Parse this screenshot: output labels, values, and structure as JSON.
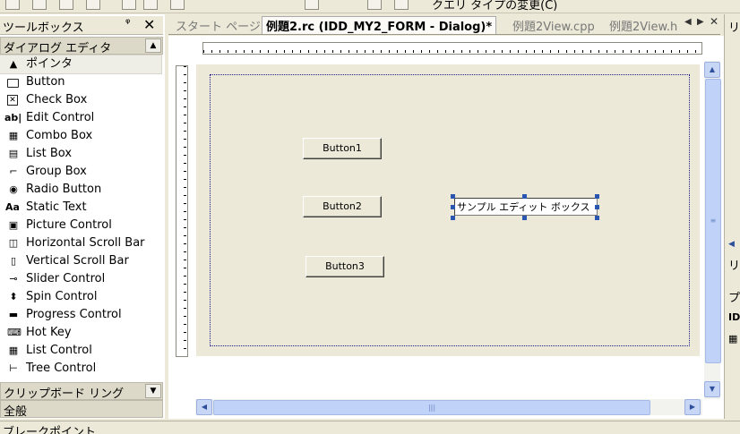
{
  "toolbar": {
    "format_label": "クエリ タイプの変更(C)"
  },
  "toolbox": {
    "title": "ツールボックス",
    "pin_glyph": "ᵠ",
    "close_glyph": "✕",
    "section_dialog": "ダイアログ エディタ",
    "items": [
      {
        "label": "ポインタ",
        "icon": "pointer-icon",
        "glyph": "▲"
      },
      {
        "label": "Button",
        "icon": "button-icon",
        "glyph": ""
      },
      {
        "label": "Check Box",
        "icon": "check-box-icon",
        "glyph": "✕"
      },
      {
        "label": "Edit Control",
        "icon": "edit-control-icon",
        "glyph": "ab|"
      },
      {
        "label": "Combo Box",
        "icon": "combo-box-icon",
        "glyph": "▦"
      },
      {
        "label": "List Box",
        "icon": "list-box-icon",
        "glyph": "▤"
      },
      {
        "label": "Group Box",
        "icon": "group-box-icon",
        "glyph": "⌐"
      },
      {
        "label": "Radio Button",
        "icon": "radio-button-icon",
        "glyph": "◉"
      },
      {
        "label": "Static Text",
        "icon": "static-text-icon",
        "glyph": "Aa"
      },
      {
        "label": "Picture Control",
        "icon": "picture-control-icon",
        "glyph": "▣"
      },
      {
        "label": "Horizontal Scroll Bar",
        "icon": "hscroll-bar-icon",
        "glyph": "◫"
      },
      {
        "label": "Vertical Scroll Bar",
        "icon": "vscroll-bar-icon",
        "glyph": "▯"
      },
      {
        "label": "Slider Control",
        "icon": "slider-control-icon",
        "glyph": "⊸"
      },
      {
        "label": "Spin Control",
        "icon": "spin-control-icon",
        "glyph": "⬍"
      },
      {
        "label": "Progress Control",
        "icon": "progress-control-icon",
        "glyph": "▬"
      },
      {
        "label": "Hot Key",
        "icon": "hot-key-icon",
        "glyph": "⌨"
      },
      {
        "label": "List Control",
        "icon": "list-control-icon",
        "glyph": "▦"
      },
      {
        "label": "Tree Control",
        "icon": "tree-control-icon",
        "glyph": "⊢"
      }
    ],
    "section_clipboard": "クリップボード リング",
    "section_general": "全般"
  },
  "tabs": [
    {
      "label": "スタート ページ"
    },
    {
      "label": "例題2.rc (IDD_MY2_FORM - Dialog)*"
    },
    {
      "label": "例題2View.cpp"
    },
    {
      "label": "例題2View.h"
    }
  ],
  "dialog": {
    "button1": "Button1",
    "button2": "Button2",
    "button3": "Button3",
    "edit_text": "サンプル エディット ボックス"
  },
  "right_panel": {
    "top_label": "リ",
    "mid_label": "プ",
    "id_label": "ID"
  },
  "bottom_panel": {
    "title": "ブレークポイント"
  }
}
